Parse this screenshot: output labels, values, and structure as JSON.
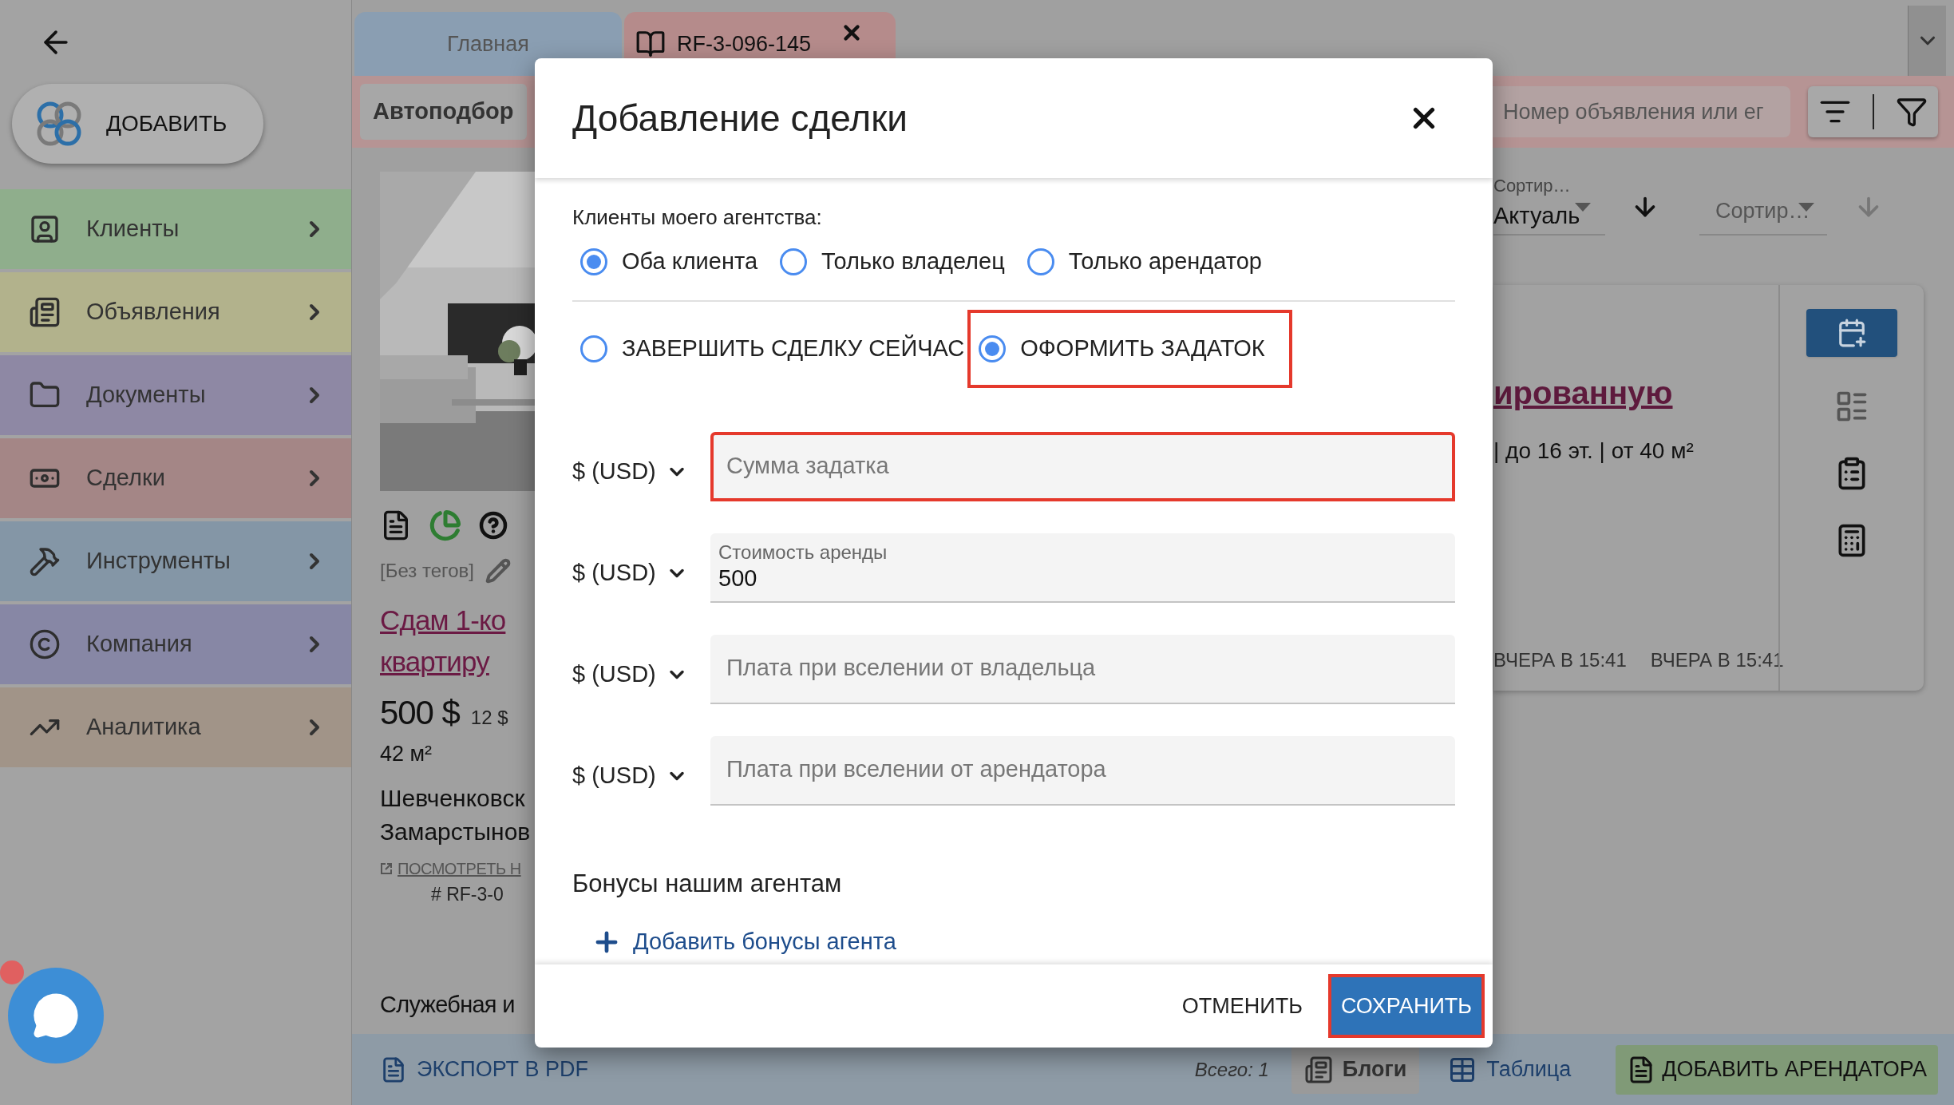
{
  "sidebar": {
    "add_button": "ДОБАВИТЬ",
    "items": [
      {
        "label": "Клиенты",
        "color": "#8fae8c"
      },
      {
        "label": "Объявления",
        "color": "#b2b28c"
      },
      {
        "label": "Документы",
        "color": "#8e88a4"
      },
      {
        "label": "Сделки",
        "color": "#a48686"
      },
      {
        "label": "Инструменты",
        "color": "#8496a6"
      },
      {
        "label": "Компания",
        "color": "#8787a5"
      },
      {
        "label": "Аналитика",
        "color": "#a19488"
      }
    ]
  },
  "tabs": [
    {
      "label": "Главная",
      "selected": false
    },
    {
      "label": "RF-3-096-145",
      "selected": true
    }
  ],
  "toolbar": {
    "autoselect_button": "Автоподбор",
    "search": {
      "placeholder": "Номер объявления или ег"
    }
  },
  "sort": [
    {
      "label": "Сортир…",
      "value": "Актуаль"
    },
    {
      "placeholder": "Сортир…"
    }
  ],
  "listing": {
    "tags": "[Без тегов]",
    "title_lines": [
      "Сдам 1-ко",
      "квартиру"
    ],
    "price": "500 $",
    "price_per_m2": "12 $",
    "area": "42 м²",
    "address_lines": [
      "Шевченковск",
      "Замарстынов"
    ],
    "link": "ПОСМОТРЕТЬ Н",
    "id": "# RF-3-0"
  },
  "section_title": "Служебная и",
  "request_card": {
    "title": "ированную",
    "params": "| до 16 эт. | от 40 м²",
    "dates": [
      "ВЧЕРА В 15:41",
      "ВЧЕРА В 15:41"
    ]
  },
  "dialog": {
    "title": "Добавление сделки",
    "clients_label": "Клиенты моего агентства:",
    "client_options": [
      {
        "label": "Оба клиента",
        "selected": true
      },
      {
        "label": "Только владелец",
        "selected": false
      },
      {
        "label": "Только арендатор",
        "selected": false
      }
    ],
    "deal_options": [
      {
        "label": "ЗАВЕРШИТЬ СДЕЛКУ СЕЙЧАС",
        "selected": false,
        "highlighted": false
      },
      {
        "label": "ОФОРМИТЬ ЗАДАТОК",
        "selected": true,
        "highlighted": true
      }
    ],
    "fields": [
      {
        "currency": "$ (USD)",
        "placeholder": "Сумма задатка",
        "highlighted": true
      },
      {
        "currency": "$ (USD)",
        "label": "Стоимость аренды",
        "value": "500",
        "highlighted": false
      },
      {
        "currency": "$ (USD)",
        "placeholder": "Плата при вселении от владельца",
        "highlighted": false
      },
      {
        "currency": "$ (USD)",
        "placeholder": "Плата при вселении от арендатора",
        "highlighted": false
      }
    ],
    "bonuses_title": "Бонусы нашим агентам",
    "add_bonus_link": "Добавить бонусы агента",
    "buttons": [
      {
        "label": "ОТМЕНИТЬ",
        "kind": "text",
        "highlighted": false
      },
      {
        "label": "СОХРАНИТЬ",
        "kind": "primary",
        "highlighted": true
      }
    ]
  },
  "bottom_bar": {
    "export": "ЭКСПОРТ В PDF",
    "total": "Всего: 1",
    "views": [
      {
        "label": "Блоги",
        "selected": true
      },
      {
        "label": "Таблица",
        "selected": false
      }
    ],
    "add_tenant": "ДОБАВИТЬ АРЕНДАТОРА"
  },
  "chat": {
    "unread": true
  }
}
